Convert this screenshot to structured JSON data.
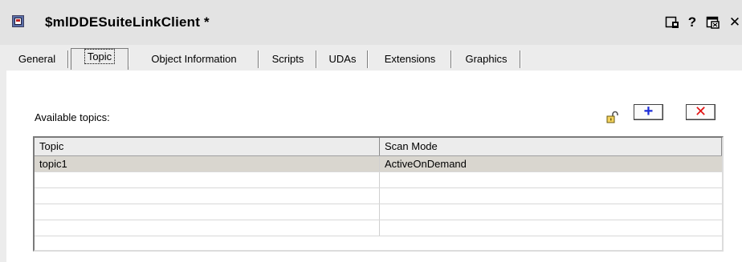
{
  "window": {
    "title": "$mlDDESuiteLinkClient *",
    "buttons": {
      "help": "?",
      "close": "✕"
    }
  },
  "tabs": [
    {
      "label": "General",
      "active": false
    },
    {
      "label": "Topic",
      "active": true
    },
    {
      "label": "Object Information",
      "active": false
    },
    {
      "label": "Scripts",
      "active": false
    },
    {
      "label": "UDAs",
      "active": false
    },
    {
      "label": "Extensions",
      "active": false
    },
    {
      "label": "Graphics",
      "active": false
    }
  ],
  "topic_panel": {
    "available_label": "Available topics:",
    "add_button": "+",
    "delete_button": "✕",
    "icons": {
      "lock": "unlock-icon",
      "add": "plus-icon",
      "delete": "delete-icon"
    },
    "columns": [
      "Topic",
      "Scan Mode"
    ],
    "rows": [
      {
        "topic": "topic1",
        "scan_mode": "ActiveOnDemand",
        "selected": true
      },
      {
        "topic": "",
        "scan_mode": ""
      },
      {
        "topic": "",
        "scan_mode": ""
      },
      {
        "topic": "",
        "scan_mode": ""
      },
      {
        "topic": "",
        "scan_mode": ""
      }
    ]
  },
  "colors": {
    "title_bar": "#e3e3e3",
    "selected_row": "#d9d6cf",
    "add_accent": "#1b2bd8",
    "delete_accent": "#e21212"
  }
}
